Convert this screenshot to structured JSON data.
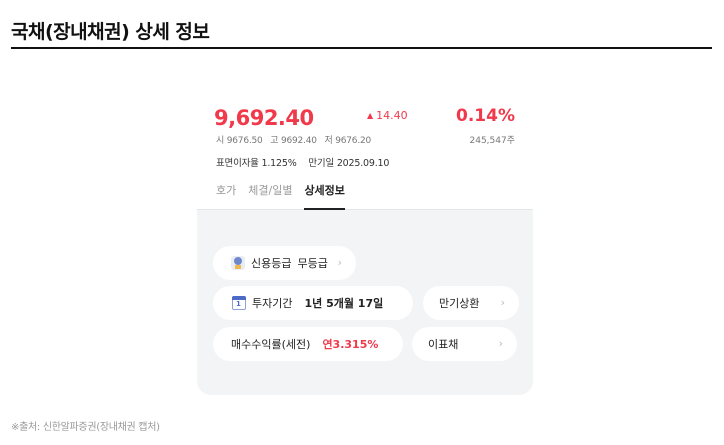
{
  "page": {
    "title": "국채(장내채권) 상세 정보",
    "source": "※출처: 신한알파증권(장내채권 캡처)"
  },
  "quote": {
    "price": "9,692.40",
    "change": "14.40",
    "change_direction": "up",
    "change_rate": "0.14%",
    "open": "시 9676.50",
    "high": "고 9692.40",
    "low": "저 9676.20",
    "volume": "245,547주",
    "coupon_rate": "표면이자율 1.125%",
    "maturity_date": "만기일 2025.09.10",
    "accent_color": "#f03a4b"
  },
  "tabs": [
    {
      "label": "호가",
      "active": false
    },
    {
      "label": "체결/일별",
      "active": false
    },
    {
      "label": "상세정보",
      "active": true
    }
  ],
  "details": {
    "credit": {
      "label": "신용등급",
      "value": "무등급",
      "icon": "medal-icon"
    },
    "period": {
      "label": "투자기간",
      "value": "1년 5개월 17일",
      "icon": "calendar-icon",
      "icon_text": "1"
    },
    "maturity_repay": {
      "label": "만기상환"
    },
    "yield": {
      "label": "매수수익률(세전)",
      "value": "연3.315%"
    },
    "coupon_type": {
      "label": "이표채"
    }
  }
}
